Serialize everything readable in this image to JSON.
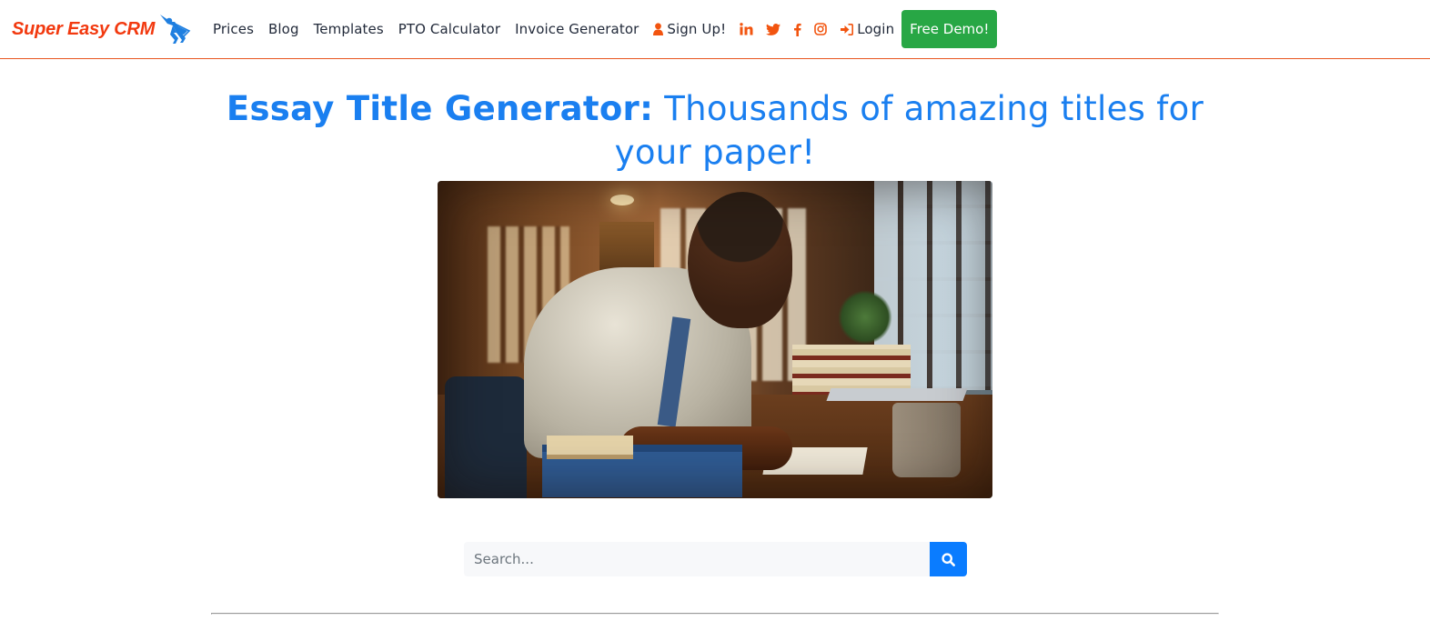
{
  "brand": {
    "name": "Super Easy CRM",
    "icon": "superhero-icon",
    "color": "#f2390f",
    "icon_color": "#1f7fe0"
  },
  "nav": {
    "links": [
      {
        "label": "Prices"
      },
      {
        "label": "Blog"
      },
      {
        "label": "Templates"
      },
      {
        "label": "PTO Calculator"
      },
      {
        "label": "Invoice Generator"
      }
    ],
    "signup": {
      "label": "Sign Up!",
      "icon": "user-icon"
    },
    "social": [
      {
        "name": "linkedin",
        "icon": "linkedin-icon"
      },
      {
        "name": "twitter",
        "icon": "twitter-icon"
      },
      {
        "name": "facebook",
        "icon": "facebook-icon"
      },
      {
        "name": "instagram",
        "icon": "instagram-icon"
      }
    ],
    "login": {
      "label": "Login",
      "icon": "sign-in-icon"
    },
    "demo_button": {
      "label": "Free Demo!",
      "color": "#28a745"
    },
    "accent_color": "#f2540f"
  },
  "hero": {
    "title_strong": "Essay Title Generator:",
    "title_rest": " Thousands of amazing titles for your paper!",
    "title_color": "#1a7ff0",
    "image_alt": "Man writing an essay at a wooden desk with books, a laptop and a mug"
  },
  "search": {
    "value": "",
    "placeholder": "Search...",
    "button_icon": "search-icon",
    "button_color": "#0a7cff"
  }
}
